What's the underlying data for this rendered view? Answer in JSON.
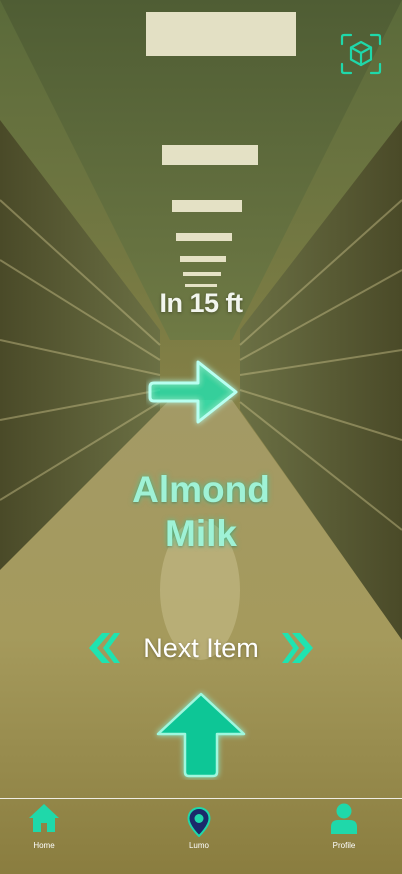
{
  "navigation": {
    "distance_text": "In 15 ft",
    "direction": "right",
    "item_name_line1": "Almond",
    "item_name_line2": "Milk",
    "next_item_label": "Next Item"
  },
  "tabs": [
    {
      "label": "Home",
      "icon": "home-icon"
    },
    {
      "label": "Lumo",
      "icon": "location-pin-icon"
    },
    {
      "label": "Profile",
      "icon": "user-icon"
    }
  ],
  "colors": {
    "accent": "#1fe3b0",
    "item_text": "#9ff2d6",
    "tab_icon": "#1fd8aa"
  }
}
